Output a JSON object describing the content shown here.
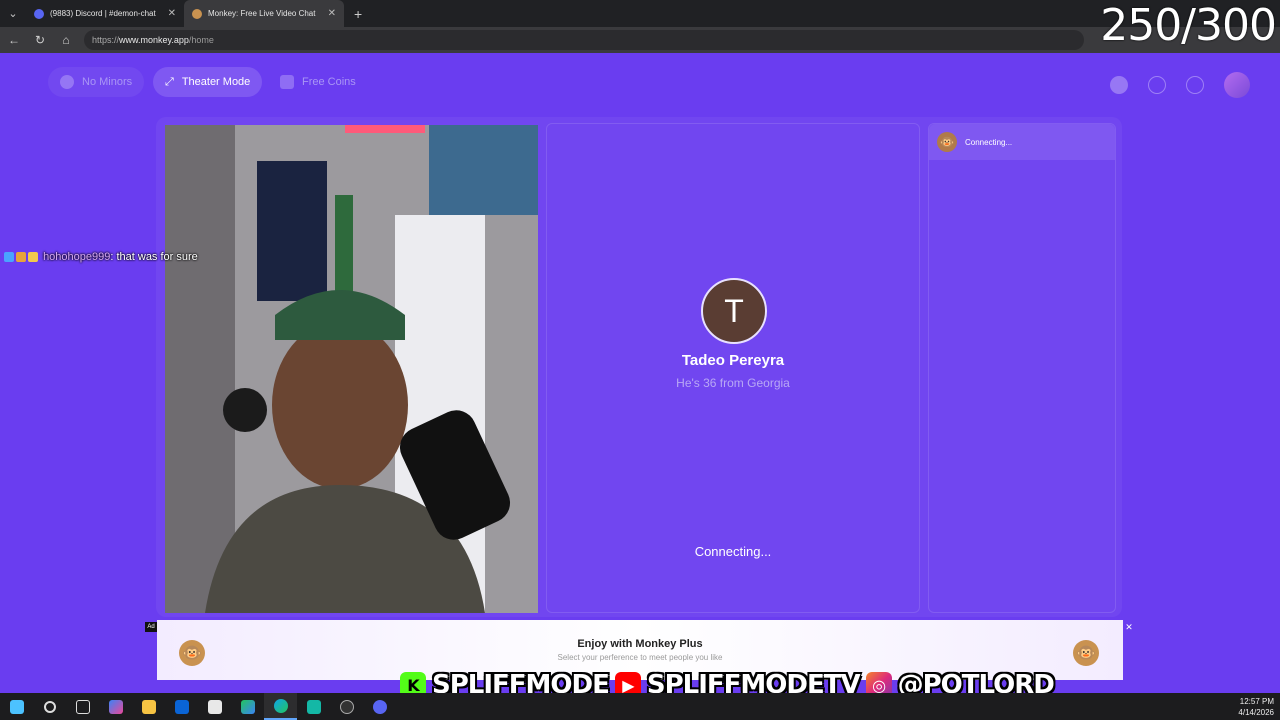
{
  "browser": {
    "tabs": [
      {
        "title": "(9883) Discord | #demon-chat",
        "active": false
      },
      {
        "title": "Monkey: Free Live Video Chat",
        "active": true
      }
    ],
    "new_tab_symbol": "+",
    "close_symbol": "✕",
    "url_scheme": "https://",
    "url_host": "www.monkey.app",
    "url_path": "/home"
  },
  "stream_overlay": {
    "counter": "250/300",
    "chat": {
      "user": "hohohope999",
      "message": ": that was for sure"
    },
    "socials": [
      {
        "icon": "kick-icon",
        "handle": "SPLIFFMODE"
      },
      {
        "icon": "youtube-icon",
        "handle": "SPLIFFMODETV"
      },
      {
        "icon": "instagram-icon",
        "handle": "@POTLORD"
      }
    ]
  },
  "app": {
    "nav": {
      "no_minors": "No Minors",
      "theater_mode": "Theater Mode",
      "free_coins": "Free Coins"
    },
    "partner": {
      "initial": "T",
      "name": "Tadeo Pereyra",
      "description": "He's 36 from Georgia",
      "status": "Connecting..."
    },
    "chat_panel": {
      "status": "Connecting..."
    }
  },
  "ad": {
    "label": "Ad",
    "title": "Enjoy with Monkey Plus",
    "subtitle": "Select your perference to meet people you like",
    "close": "✕"
  },
  "taskbar": {
    "time": "12:57 PM",
    "date": "4/14/2026"
  },
  "colors": {
    "app_background": "#6a3df0",
    "avatar_background": "#5a3d33",
    "chrome_dark": "#202124"
  }
}
